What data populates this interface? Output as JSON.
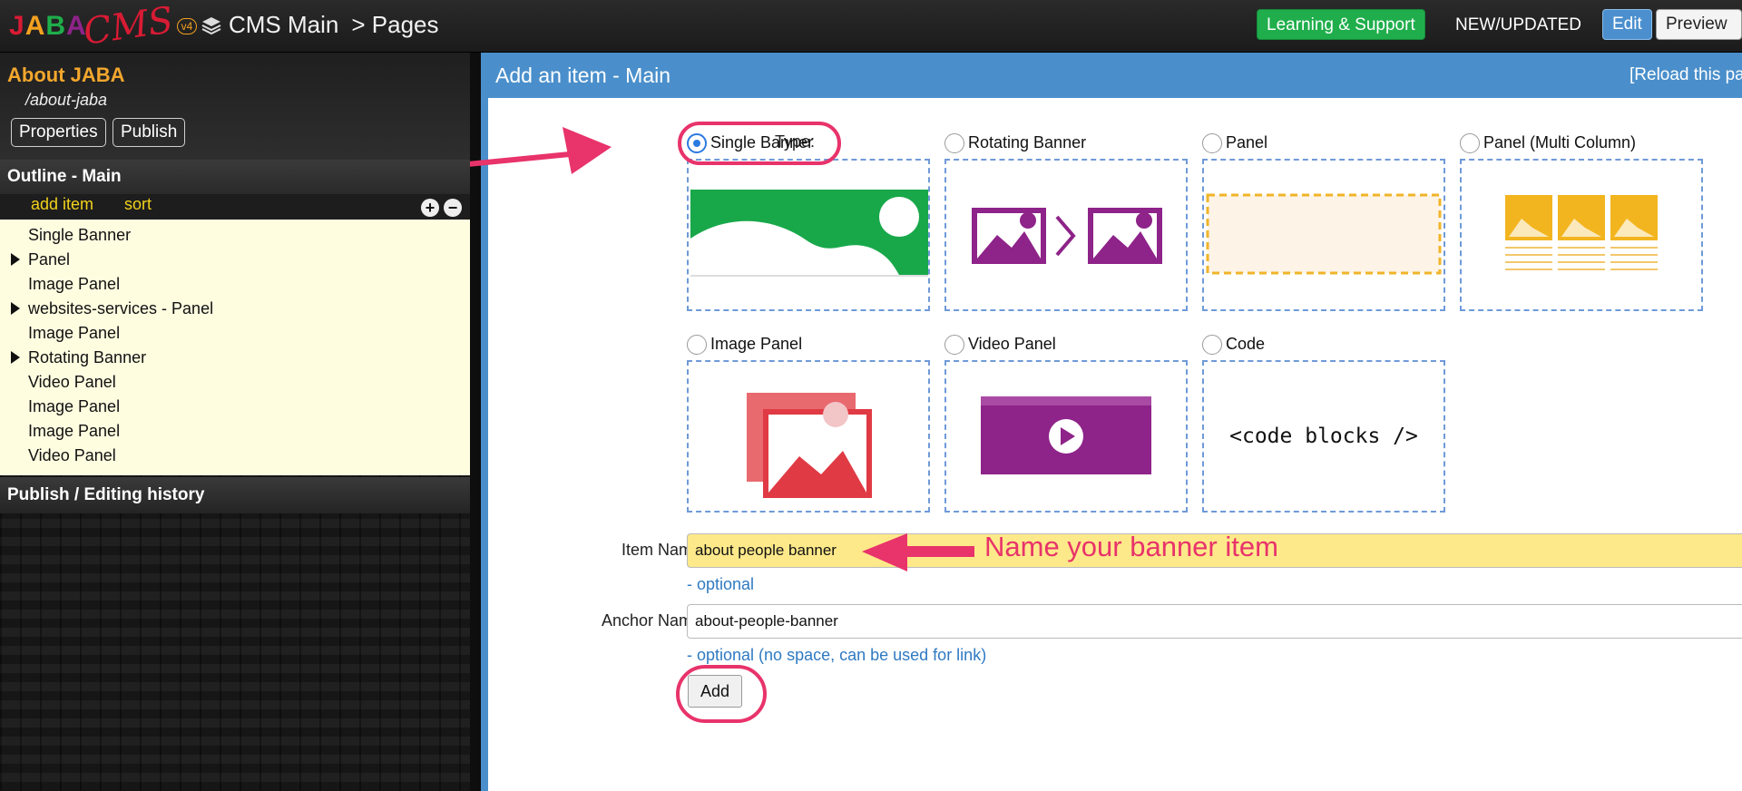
{
  "topbar": {
    "logo_text": "JABA",
    "logo_script": "CMS",
    "logo_version": "v4",
    "breadcrumb": [
      "CMS Main",
      "> Pages"
    ],
    "learning_support": "Learning & Support",
    "new_updated": "NEW/UPDATED",
    "edit": "Edit",
    "preview": "Preview"
  },
  "sidebar": {
    "page_title": "About JABA",
    "page_path": "/about-jaba",
    "properties": "Properties",
    "publish": "Publish",
    "outline_heading": "Outline - Main",
    "add_item": "add item",
    "sort": "sort",
    "outline_items": [
      {
        "label": "Single Banner",
        "expandable": false
      },
      {
        "label": "Panel",
        "expandable": true
      },
      {
        "label": "Image Panel",
        "expandable": false
      },
      {
        "label": "websites-services - Panel",
        "expandable": true
      },
      {
        "label": "Image Panel",
        "expandable": false
      },
      {
        "label": "Rotating Banner",
        "expandable": true
      },
      {
        "label": "Video Panel",
        "expandable": false
      },
      {
        "label": "Image Panel",
        "expandable": false
      },
      {
        "label": "Image Panel",
        "expandable": false
      },
      {
        "label": "Video Panel",
        "expandable": false
      }
    ],
    "history_heading": "Publish / Editing history"
  },
  "main": {
    "title": "Add an item - Main",
    "reload": "[Reload this page]",
    "type_label": "Type:",
    "types": [
      {
        "label": "Single Banner",
        "selected": true
      },
      {
        "label": "Rotating Banner",
        "selected": false
      },
      {
        "label": "Panel",
        "selected": false
      },
      {
        "label": "Panel (Multi Column)",
        "selected": false
      },
      {
        "label": "Image Panel",
        "selected": false
      },
      {
        "label": "Video Panel",
        "selected": false
      },
      {
        "label": "Code",
        "selected": false
      }
    ],
    "code_preview": "<code blocks />",
    "item_name_label": "Item Name:",
    "item_name_value": "about people banner",
    "item_name_hint": "- optional",
    "anchor_name_label": "Anchor Name:",
    "anchor_name_value": "about-people-banner",
    "anchor_name_hint": "- optional (no space, can be used for link)",
    "add_button": "Add"
  },
  "annotation": {
    "callout": "Name your banner item"
  },
  "colors": {
    "accent_blue": "#4a8fcb",
    "annotation_pink": "#e8336b",
    "outline_bg": "#fffde0",
    "highlight_yellow": "#fde98a",
    "learn_green": "#1fae4b"
  }
}
